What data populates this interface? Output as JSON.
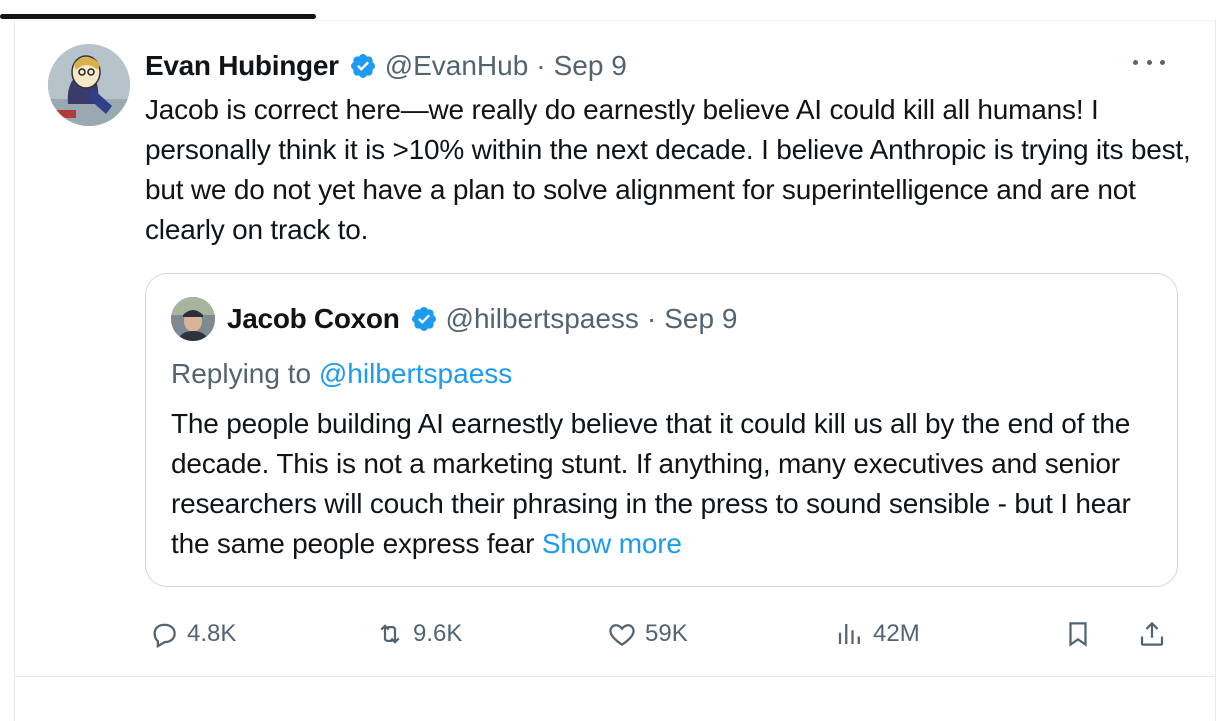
{
  "tweet": {
    "author_name": "Evan Hubinger",
    "handle": "@EvanHub",
    "separator": "·",
    "date": "Sep 9",
    "text": "Jacob is correct here—we really do earnestly believe AI could kill all humans! I personally think it is >10% within the next decade. I believe Anthropic is trying its best, but we do not yet have a plan to solve alignment for superintelligence and are not clearly on track to."
  },
  "quote": {
    "author_name": "Jacob Coxon",
    "handle": "@hilbertspaess",
    "separator": "·",
    "date": "Sep 9",
    "replying_prefix": "Replying to ",
    "replying_handle": "@hilbertspaess",
    "text": "The people building AI earnestly believe that it could kill us all by the end of the decade. This is not a marketing stunt. If anything, many executives and senior researchers will couch their phrasing in the press to sound sensible - but I hear the same people express fear ",
    "show_more": "Show more"
  },
  "actions": {
    "replies": "4.8K",
    "reposts": "9.6K",
    "likes": "59K",
    "views": "42M"
  },
  "colors": {
    "text": "#0f1419",
    "secondary": "#536471",
    "link": "#1d9bf0",
    "verified": "#1d9bf0",
    "border": "#cfd9de"
  },
  "icons": [
    "verified-badge-icon",
    "more-icon",
    "reply-icon",
    "repost-icon",
    "like-icon",
    "views-icon",
    "bookmark-icon",
    "share-icon"
  ]
}
